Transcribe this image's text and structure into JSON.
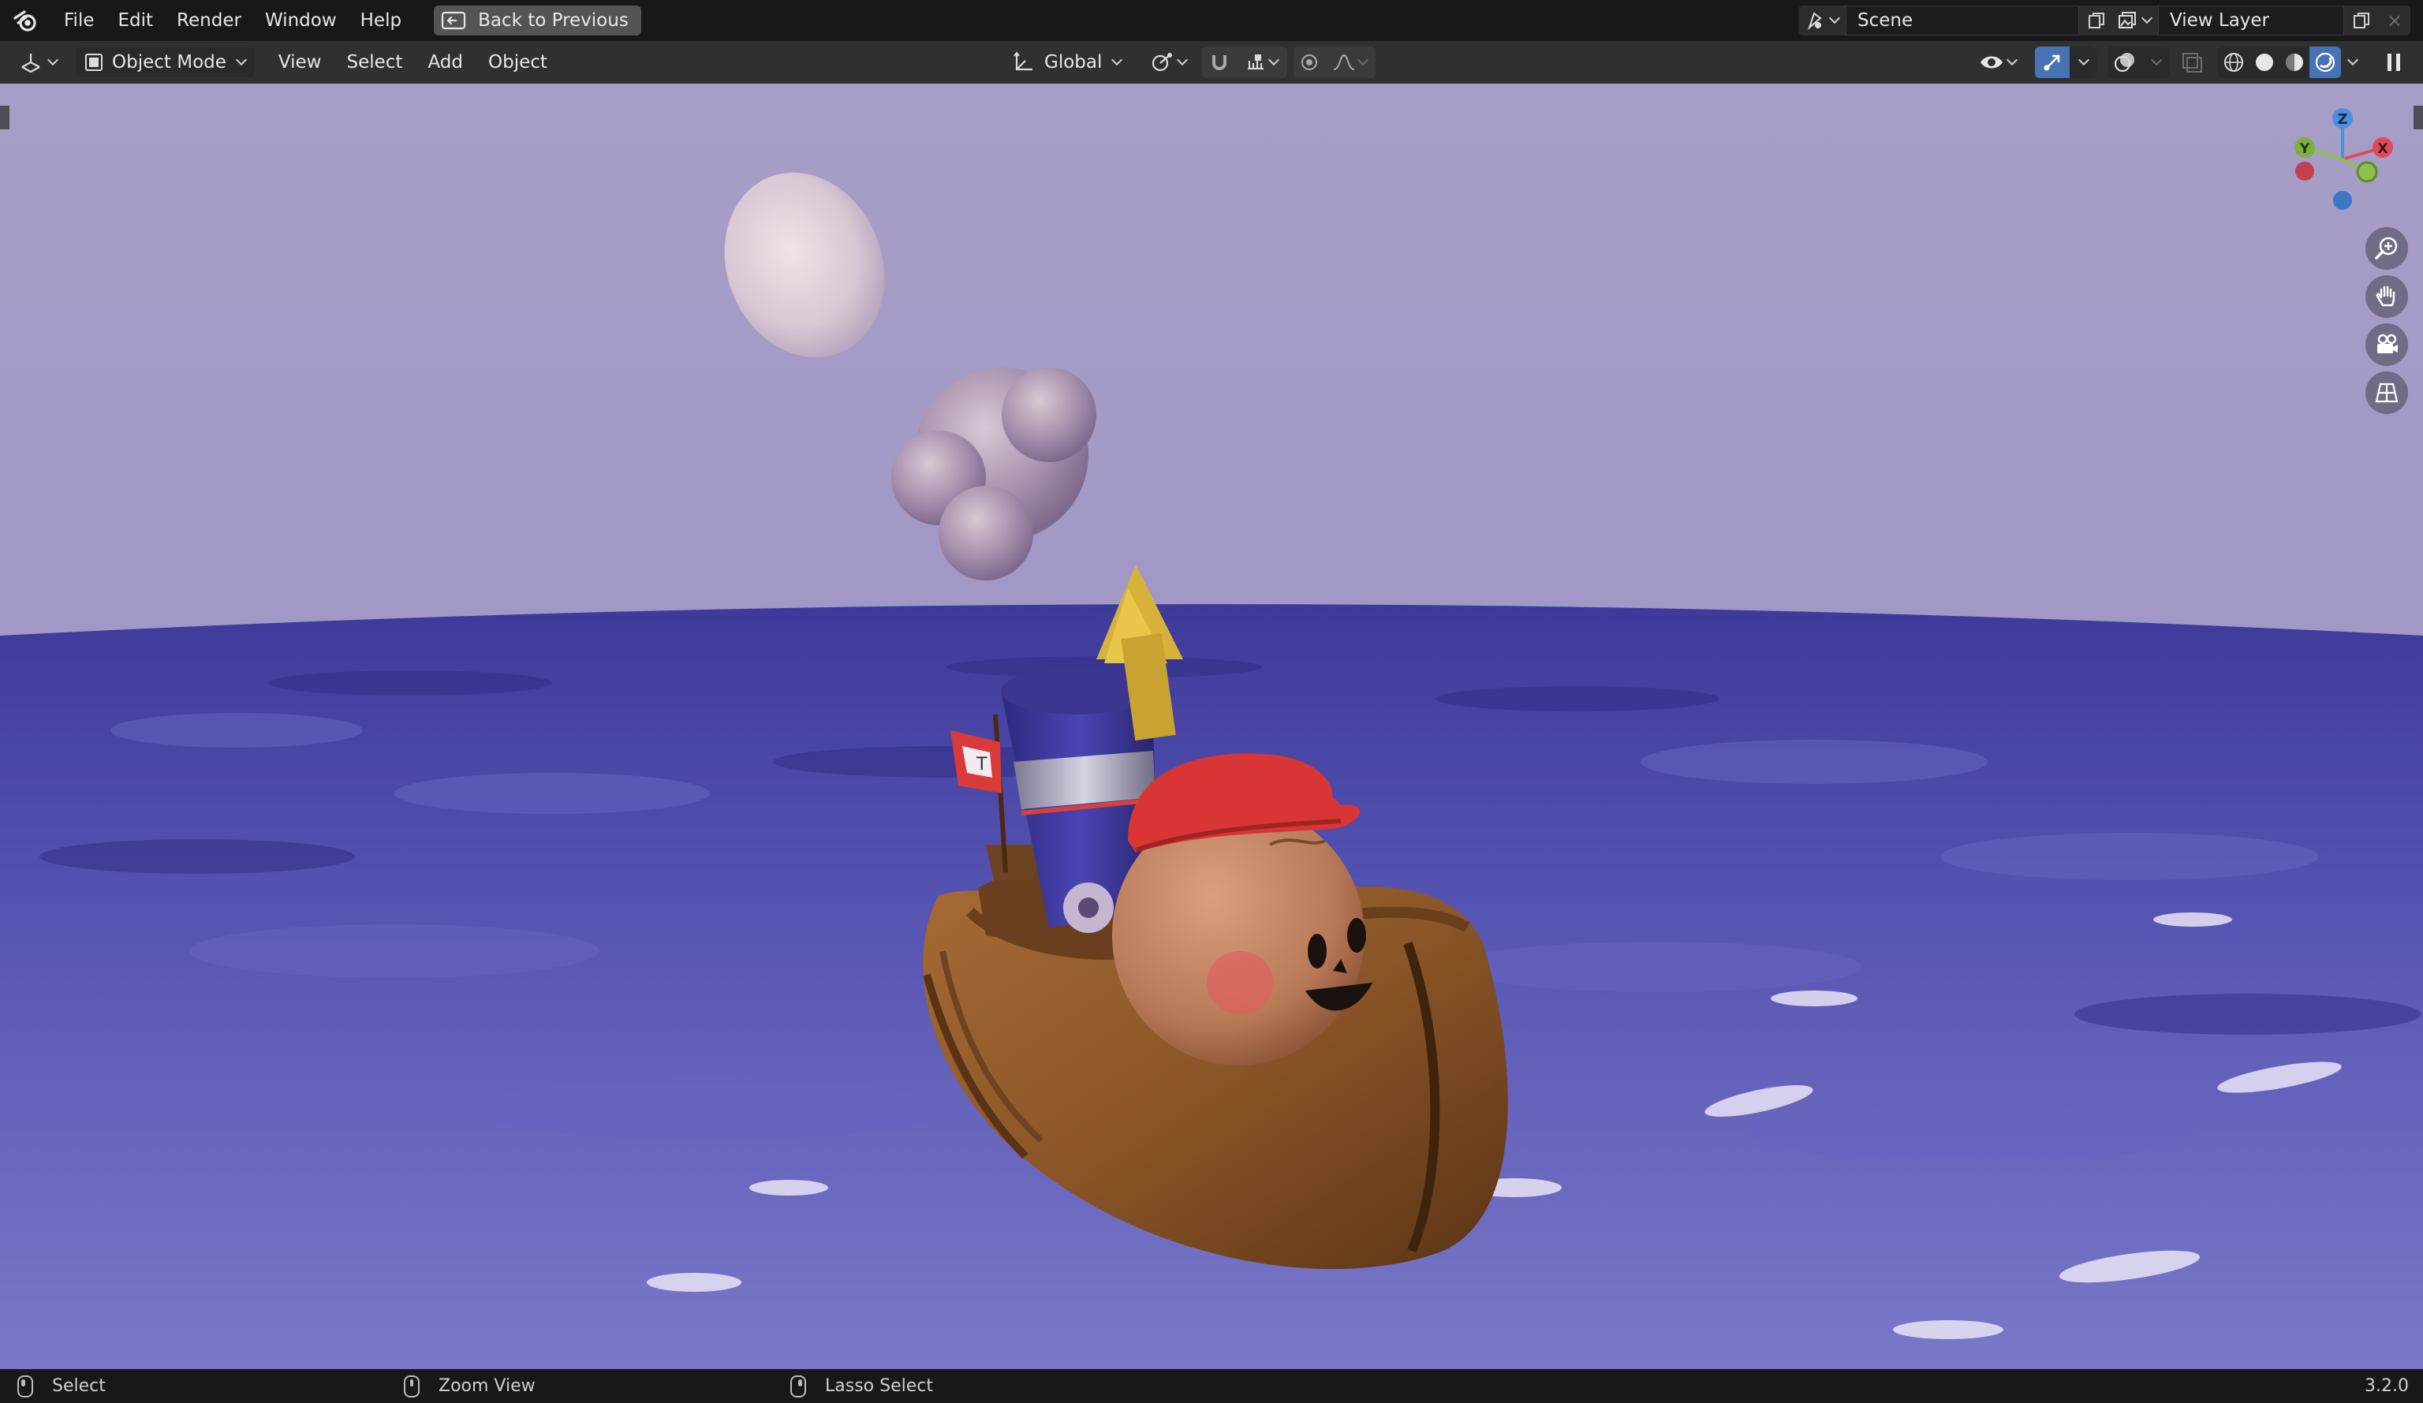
{
  "topbar": {
    "menus": [
      "File",
      "Edit",
      "Render",
      "Window",
      "Help"
    ],
    "back_button": "Back to Previous",
    "scene": "Scene",
    "view_layer": "View Layer"
  },
  "header": {
    "mode": "Object Mode",
    "menus": [
      "View",
      "Select",
      "Add",
      "Object"
    ],
    "transform_orientation": "Global"
  },
  "gizmo": {
    "z": "Z",
    "y": "Y",
    "x": "X"
  },
  "flag_letter": "T",
  "statusbar": {
    "left_click": "Select",
    "middle_click": "Zoom View",
    "right_click": "Lasso Select",
    "version": "3.2.0"
  },
  "colors": {
    "accent": "#4772b3",
    "axis_x": "#e04a5a",
    "axis_y": "#8bc34a",
    "axis_z": "#4a8fe0",
    "sky": "#9d95c4",
    "water": "#5a58b8"
  }
}
